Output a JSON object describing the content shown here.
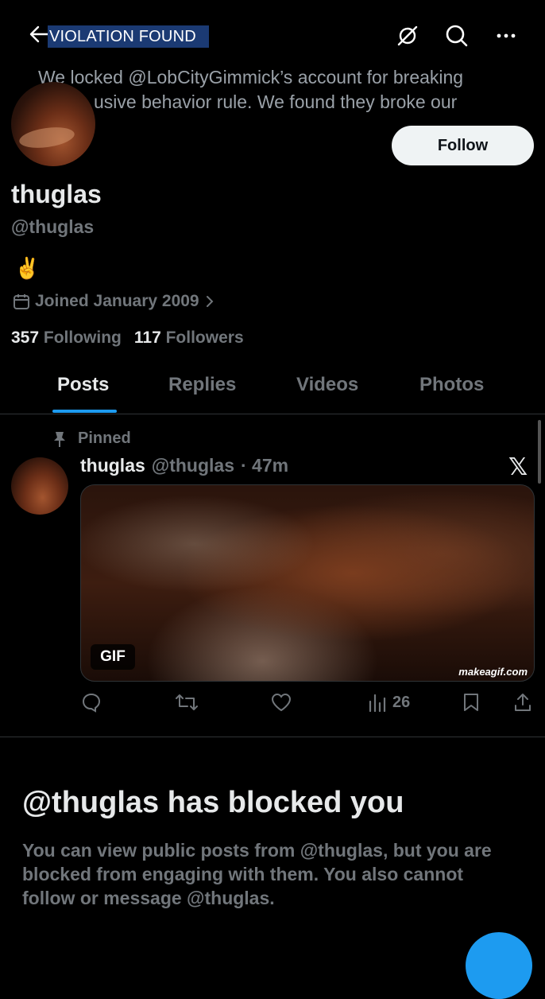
{
  "header": {
    "banner_label": "VIOLATION FOUND",
    "icons": [
      "back-arrow-icon",
      "grok-icon",
      "search-icon",
      "more-icon"
    ]
  },
  "notice": {
    "line1": "We locked @LobCityGimmick’s account for breaking",
    "line2": "usive behavior rule. We found they broke our"
  },
  "profile": {
    "follow_label": "Follow",
    "display_name": "thuglas",
    "handle": "@thuglas",
    "bio": "✌️",
    "joined": "Joined January 2009",
    "following_count": "357",
    "following_label": "Following",
    "followers_count": "117",
    "followers_label": "Followers"
  },
  "tabs": [
    {
      "label": "Posts"
    },
    {
      "label": "Replies"
    },
    {
      "label": "Videos"
    },
    {
      "label": "Photos"
    }
  ],
  "post": {
    "pinned_label": "Pinned",
    "name": "thuglas",
    "handle": "@thuglas",
    "time": "· 47m",
    "source_logo": "𝕏",
    "gif_label": "GIF",
    "watermark": "makeagif.com",
    "views": "26"
  },
  "blocked": {
    "title": "@thuglas has blocked you",
    "description": "You can view public posts from @thuglas, but you are blocked from engaging with them. You also cannot follow or message @thuglas."
  },
  "colors": {
    "accent": "#1d9bf0",
    "muted": "#71767b",
    "text": "#e7e9ea",
    "banner": "#1b3a73"
  }
}
